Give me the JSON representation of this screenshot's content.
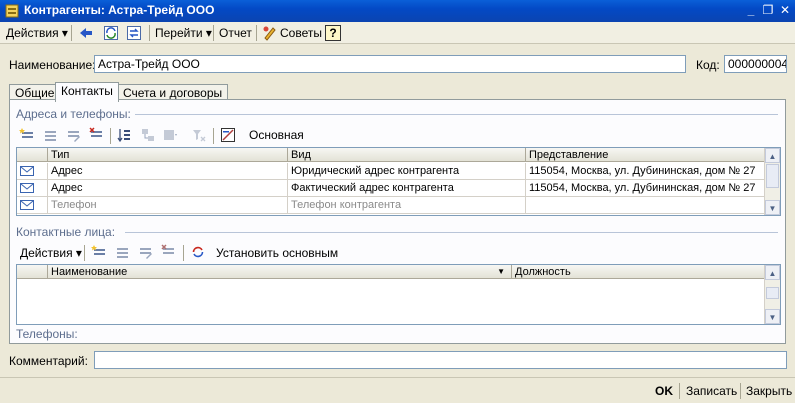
{
  "window": {
    "title": "Контрагенты: Астра-Трейд ООО"
  },
  "toolbar": {
    "actions_label": "Действия",
    "goto_label": "Перейти",
    "report_label": "Отчет",
    "tips_label": "Советы",
    "help_label": "?"
  },
  "form": {
    "name_label": "Наименование:",
    "name_value": "Астра-Трейд ООО",
    "code_label": "Код:",
    "code_value": "000000004",
    "comment_label": "Комментарий:",
    "comment_value": ""
  },
  "tabs": [
    {
      "label": "Общие"
    },
    {
      "label": "Контакты"
    },
    {
      "label": "Счета и договоры"
    }
  ],
  "addresses": {
    "title": "Адреса и телефоны:",
    "main_label": "Основная",
    "columns": [
      "Тип",
      "Вид",
      "Представление"
    ],
    "rows": [
      {
        "type": "Адрес",
        "kind": "Юридический адрес контрагента",
        "view": "115054, Москва, ул. Дубининская, дом № 27"
      },
      {
        "type": "Адрес",
        "kind": "Фактический адрес контрагента",
        "view": "115054, Москва, ул. Дубининская, дом № 27"
      },
      {
        "type": "Телефон",
        "kind": "Телефон контрагента",
        "view": ""
      }
    ]
  },
  "contacts": {
    "title": "Контактные лица:",
    "actions_label": "Действия",
    "set_main_label": "Установить основным",
    "columns": [
      "Наименование",
      "Должность"
    ],
    "phones_label": "Телефоны:"
  },
  "footer": {
    "ok_label": "OK",
    "save_label": "Записать",
    "close_label": "Закрыть"
  }
}
